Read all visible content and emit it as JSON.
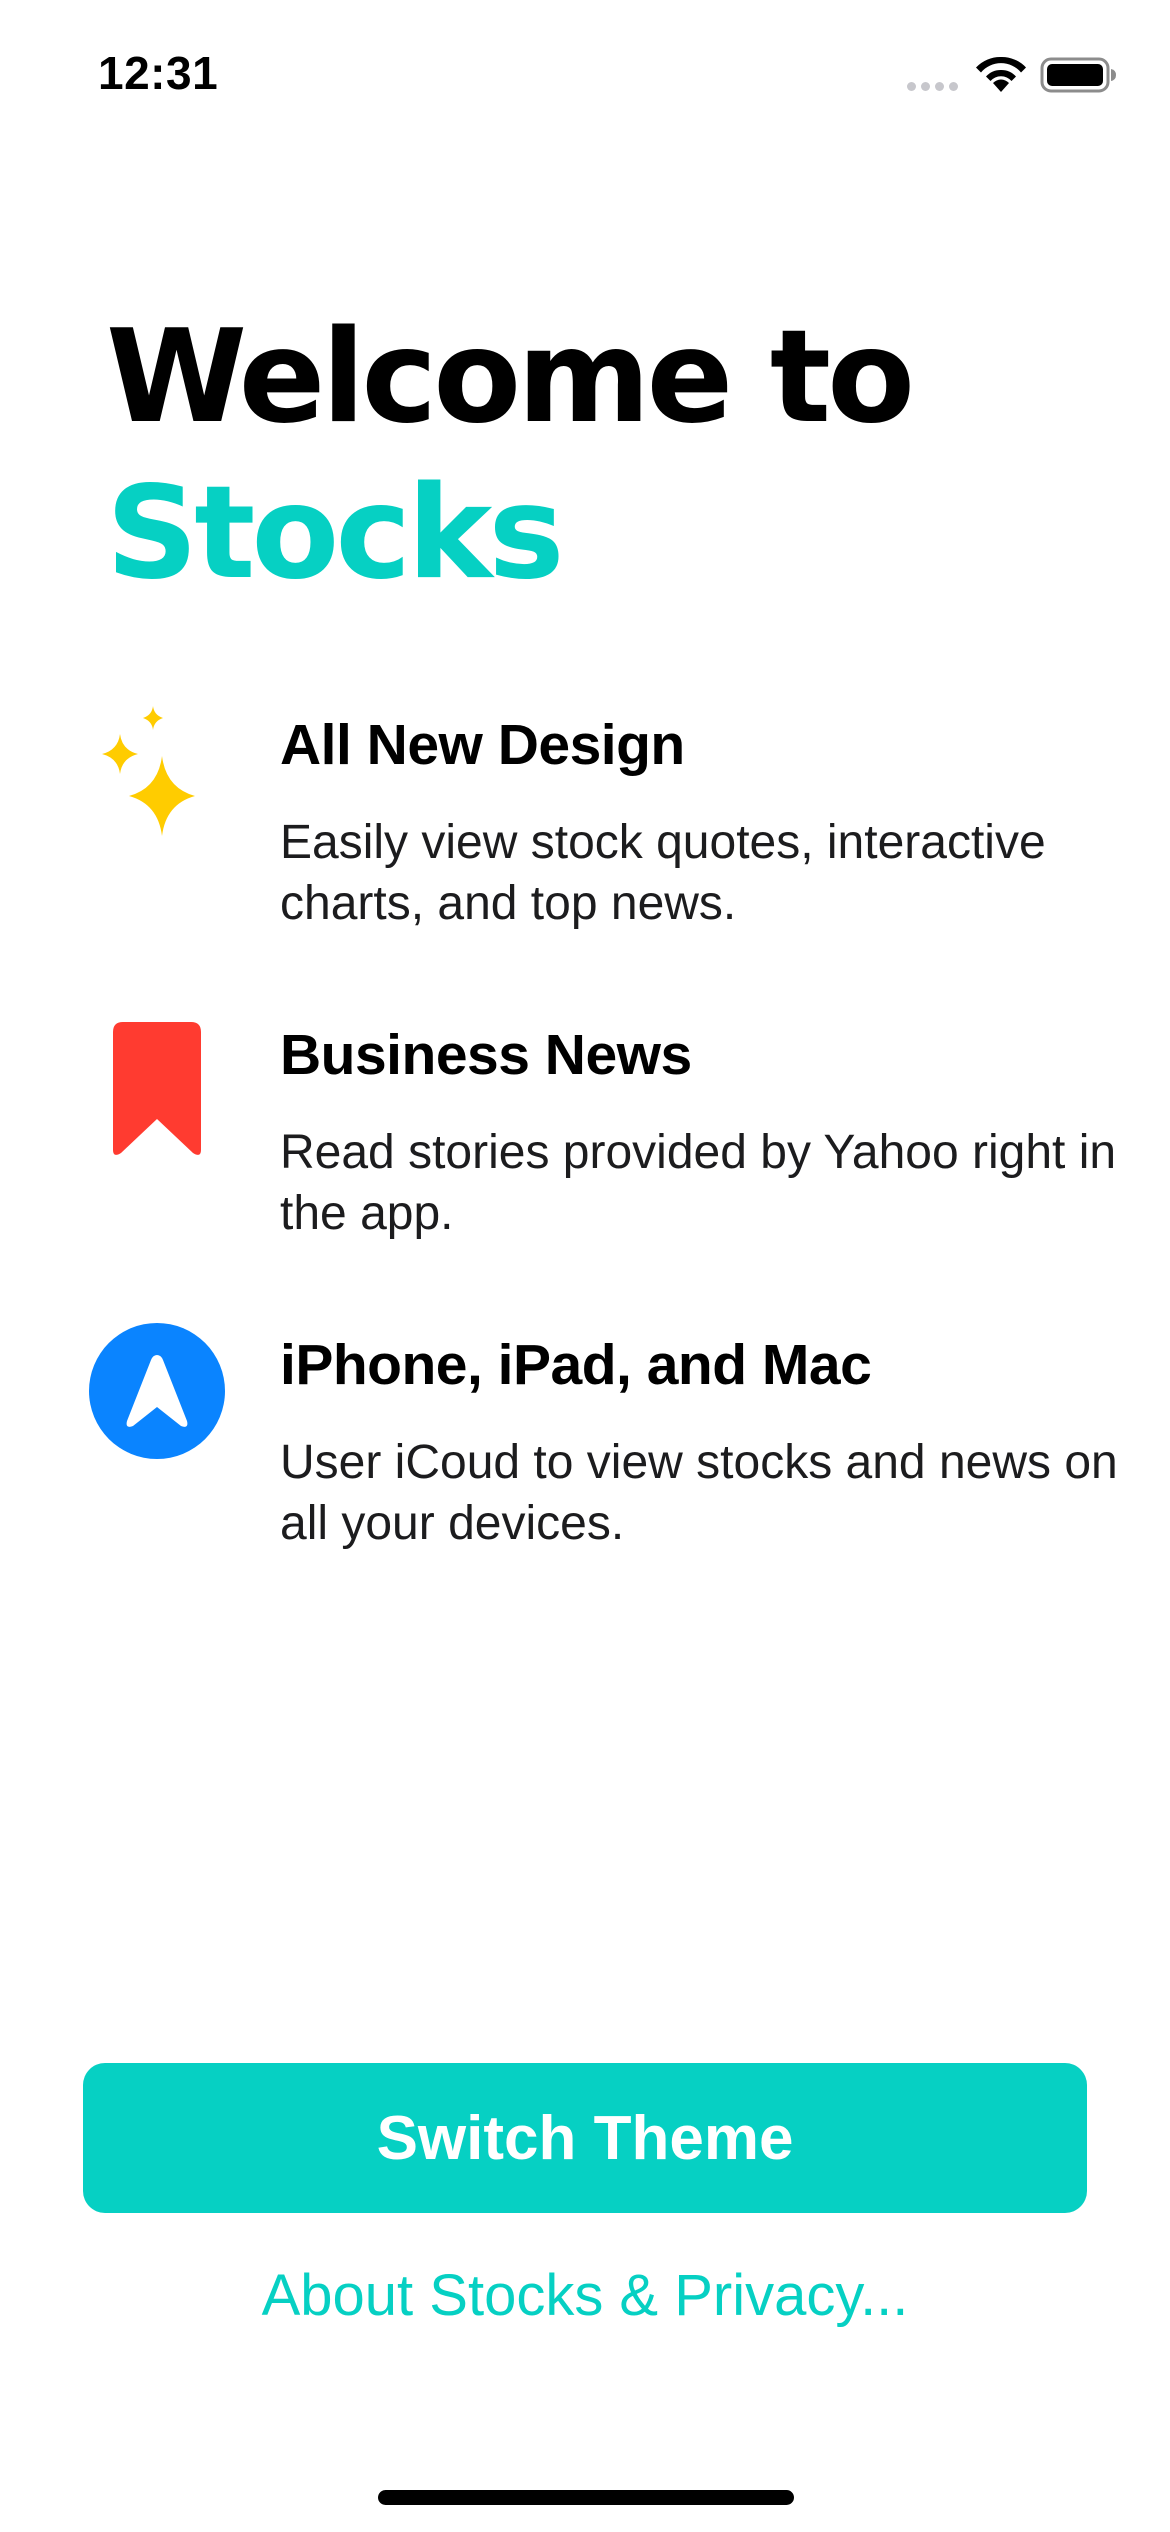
{
  "status_bar": {
    "time": "12:31"
  },
  "header": {
    "title_line1": "Welcome to",
    "title_line2": "Stocks"
  },
  "features": [
    {
      "icon": "sparkles-icon",
      "title": "All New Design",
      "description": "Easily view stock quotes, interactive charts, and top news."
    },
    {
      "icon": "bookmark-icon",
      "title": "Business News",
      "description": "Read stories provided by Yahoo right in the app."
    },
    {
      "icon": "location-arrow-icon",
      "title": "iPhone, iPad, and Mac",
      "description": "User iCoud to view stocks and news on all your devices."
    }
  ],
  "actions": {
    "switch_theme_label": "Switch Theme",
    "about_link_label": "About Stocks & Privacy..."
  },
  "colors": {
    "accent": "#06d0c3",
    "sparkles": "#ffcc00",
    "bookmark": "#ff3b30",
    "location": "#0a84ff"
  }
}
